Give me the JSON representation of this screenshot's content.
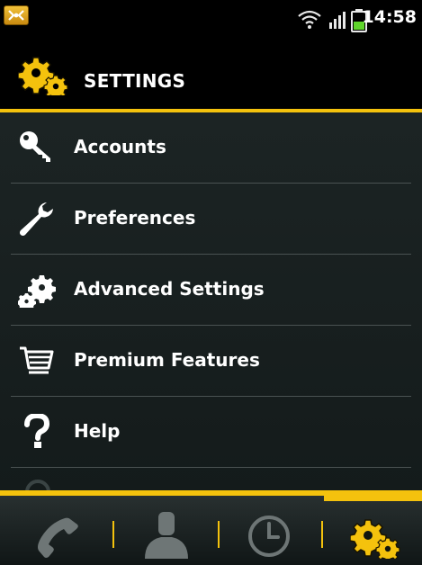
{
  "status_bar": {
    "time": "14:58",
    "icons": [
      "notification-app-icon",
      "wifi-icon",
      "signal-icon",
      "battery-icon"
    ]
  },
  "header": {
    "title": "SETTINGS",
    "icon": "gears-icon"
  },
  "settings": {
    "items": [
      {
        "label": "Accounts",
        "icon": "key-icon"
      },
      {
        "label": "Preferences",
        "icon": "wrench-icon"
      },
      {
        "label": "Advanced Settings",
        "icon": "gears-icon"
      },
      {
        "label": "Premium Features",
        "icon": "shopping-cart-icon"
      },
      {
        "label": "Help",
        "icon": "question-icon"
      }
    ]
  },
  "tabs": [
    {
      "name": "phone",
      "icon": "phone-icon",
      "active": false
    },
    {
      "name": "contacts",
      "icon": "person-icon",
      "active": false
    },
    {
      "name": "history",
      "icon": "clock-icon",
      "active": false
    },
    {
      "name": "settings",
      "icon": "gears-icon",
      "active": true
    }
  ],
  "colors": {
    "accent": "#f4c20d",
    "background": "#1c2424",
    "text": "#ffffff",
    "inactive_tab_icon": "#6e7676",
    "divider": "#4a5252"
  }
}
